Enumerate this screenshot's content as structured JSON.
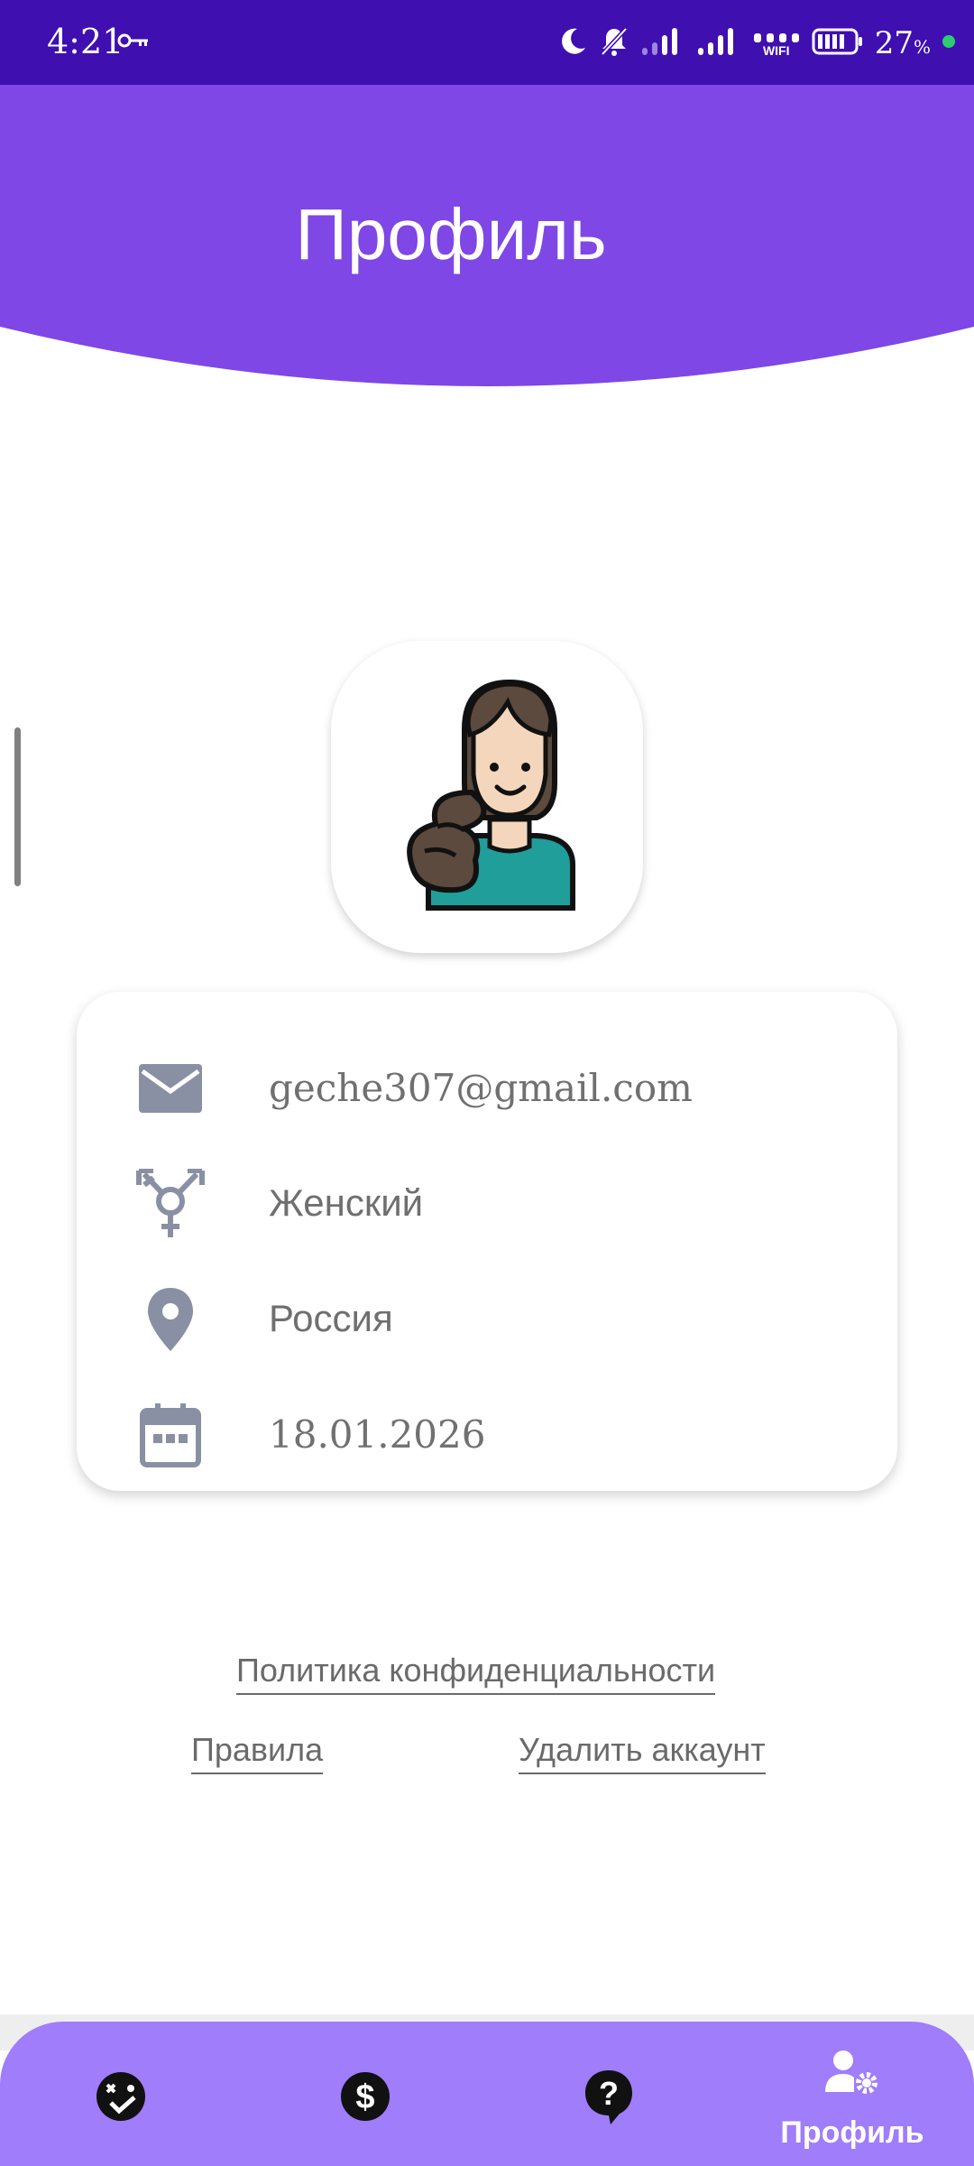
{
  "status_bar": {
    "time": "4:21",
    "battery_percent": "27",
    "battery_unit": "%",
    "wifi_label": "WIFI",
    "icons": [
      "key-icon",
      "moon-icon",
      "bell-off-icon",
      "signal-icon",
      "signal-icon",
      "wifi-icon",
      "battery-icon",
      "dot-icon"
    ]
  },
  "header": {
    "title": "Профиль",
    "color": "#7e47e6"
  },
  "profile": {
    "avatar": "woman-avatar-icon",
    "email": "geche307@gmail.com",
    "gender": "Женский",
    "country": "Россия",
    "date": "18.01.2026",
    "icon_color": "#8a90a3"
  },
  "links": {
    "privacy": "Политика конфиденциальности",
    "rules": "Правила",
    "delete": "Удалить аккаунт"
  },
  "bottom_nav": {
    "color": "#9f7dfb",
    "items": [
      {
        "icon": "face-check-icon",
        "label": ""
      },
      {
        "icon": "dollar-icon",
        "label": ""
      },
      {
        "icon": "question-bubble-icon",
        "label": ""
      },
      {
        "icon": "user-settings-icon",
        "label": "Профиль",
        "active": true
      }
    ]
  }
}
